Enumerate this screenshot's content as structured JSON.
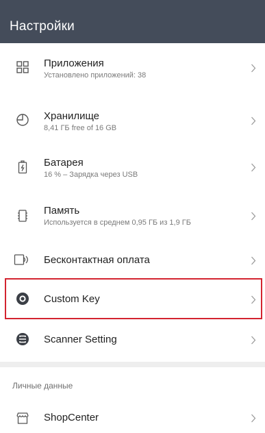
{
  "header": {
    "title": "Настройки"
  },
  "items": [
    {
      "key": "apps",
      "icon": "grid-icon",
      "title": "Приложения",
      "subtitle": "Установлено приложений: 38"
    },
    {
      "key": "storage",
      "icon": "pie-chart-icon",
      "title": "Хранилище",
      "subtitle": "8,41 ГБ free of 16 GB"
    },
    {
      "key": "battery",
      "icon": "battery-icon",
      "title": "Батарея",
      "subtitle": "16 % – Зарядка через USB"
    },
    {
      "key": "memory",
      "icon": "memory-chip-icon",
      "title": "Память",
      "subtitle": "Используется в среднем 0,95 ГБ из 1,9 ГБ"
    },
    {
      "key": "nfc",
      "icon": "contactless-payment-icon",
      "title": "Бесконтактная оплата"
    },
    {
      "key": "custom-key",
      "icon": "custom-key-icon",
      "title": "Custom Key"
    },
    {
      "key": "scanner",
      "icon": "scanner-icon",
      "title": "Scanner Setting"
    }
  ],
  "personal_section": {
    "header": "Личные данные",
    "items": [
      {
        "key": "shopcenter",
        "icon": "shop-icon",
        "title": "ShopCenter"
      }
    ]
  },
  "highlight_color": "#d3232f",
  "app_bar_color": "#444c5a"
}
